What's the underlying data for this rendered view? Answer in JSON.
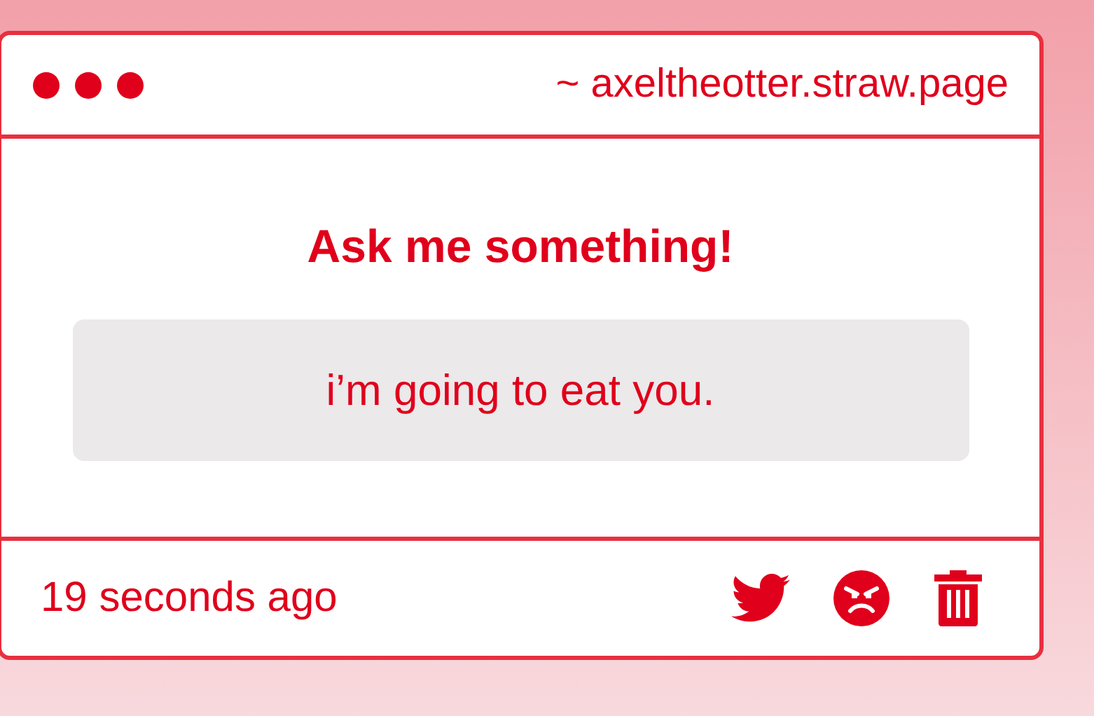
{
  "window": {
    "address": "~ axeltheotter.straw.page"
  },
  "question": {
    "heading": "Ask me something!",
    "text": "i’m going to eat you."
  },
  "footer": {
    "time": "19 seconds ago"
  }
}
